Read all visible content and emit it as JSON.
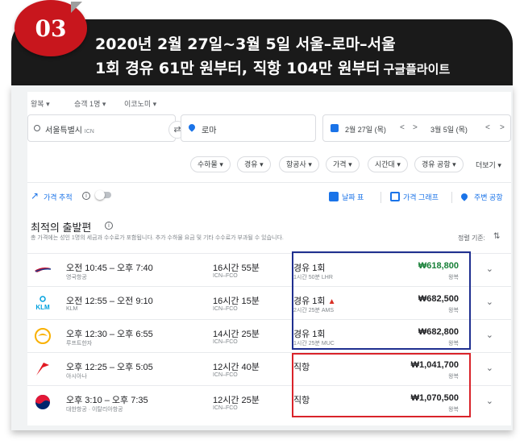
{
  "header": {
    "badge_number": "03",
    "title_line1": "2020년 2월 27일~3월 5일 서울–로마–서울",
    "title_line2": "1회 경유 61만 원부터, 직항 104만 원부터",
    "title_source": "구글플라이트",
    "colors": {
      "badge": "#c8161d",
      "banner": "#1a1a1a"
    }
  },
  "search": {
    "trip_type": "왕복",
    "passengers": "승객 1명",
    "cabin": "이코노미",
    "origin": "서울특별시",
    "origin_code": "ICN",
    "destination": "로마",
    "depart_date": "2월 27일 (목)",
    "return_date": "3월 5일 (목)",
    "prev": "<",
    "next": ">"
  },
  "filters": {
    "chips": [
      "수하물",
      "경유",
      "항공사",
      "가격",
      "시간대",
      "경유 공항"
    ],
    "more": "더보기"
  },
  "tools": {
    "price_tracking": "가격 추적",
    "date_grid": "날짜 표",
    "price_graph": "가격 그래프",
    "nearby_airports": "주변 공항"
  },
  "results": {
    "section_title": "최적의 출발편",
    "note": "총 가격에는 성인 1명의 세금과 수수료가 포함됩니다. 추가 수하물 요금 및 기타 수수료가 부과될 수 있습니다.",
    "sort_label": "정렬 기준:",
    "flights": [
      {
        "logo": "british-airways",
        "time": "오전 10:45 – 오후 7:40",
        "airline": "영국항공",
        "duration": "16시간 55분",
        "route": "ICN–FCO",
        "stops": "경유 1회",
        "layover": "1시간 50분 LHR",
        "price": "₩618,800",
        "trip": "왕복",
        "warning": false,
        "price_color": "#188038"
      },
      {
        "logo": "klm",
        "time": "오전 12:55 – 오전 9:10",
        "airline": "KLM",
        "duration": "16시간 15분",
        "route": "ICN–FCO",
        "stops": "경유 1회",
        "layover": "2시간 25분 AMS",
        "price": "₩682,500",
        "trip": "왕복",
        "warning": true,
        "price_color": "#202124"
      },
      {
        "logo": "lufthansa",
        "time": "오후 12:30 – 오후 6:55",
        "airline": "루프트한자",
        "duration": "14시간 25분",
        "route": "ICN–FCO",
        "stops": "경유 1회",
        "layover": "1시간 25분 MUC",
        "price": "₩682,800",
        "trip": "왕복",
        "warning": false,
        "price_color": "#202124"
      },
      {
        "logo": "asiana",
        "time": "오후 12:25 – 오후 5:05",
        "airline": "아시아나",
        "duration": "12시간 40분",
        "route": "ICN–FCO",
        "stops": "직항",
        "layover": "",
        "price": "₩1,041,700",
        "trip": "왕복",
        "warning": false,
        "price_color": "#202124"
      },
      {
        "logo": "korean-air",
        "time": "오후 3:10 – 오후 7:35",
        "airline": "대한항공 · 이탈리아항공",
        "duration": "12시간 25분",
        "route": "ICN–FCO",
        "stops": "직항",
        "layover": "",
        "price": "₩1,070,500",
        "trip": "왕복",
        "warning": false,
        "price_color": "#202124"
      }
    ]
  },
  "highlights": {
    "layover_box_color": "#1f2f8f",
    "nonstop_box_color": "#d9232a"
  }
}
